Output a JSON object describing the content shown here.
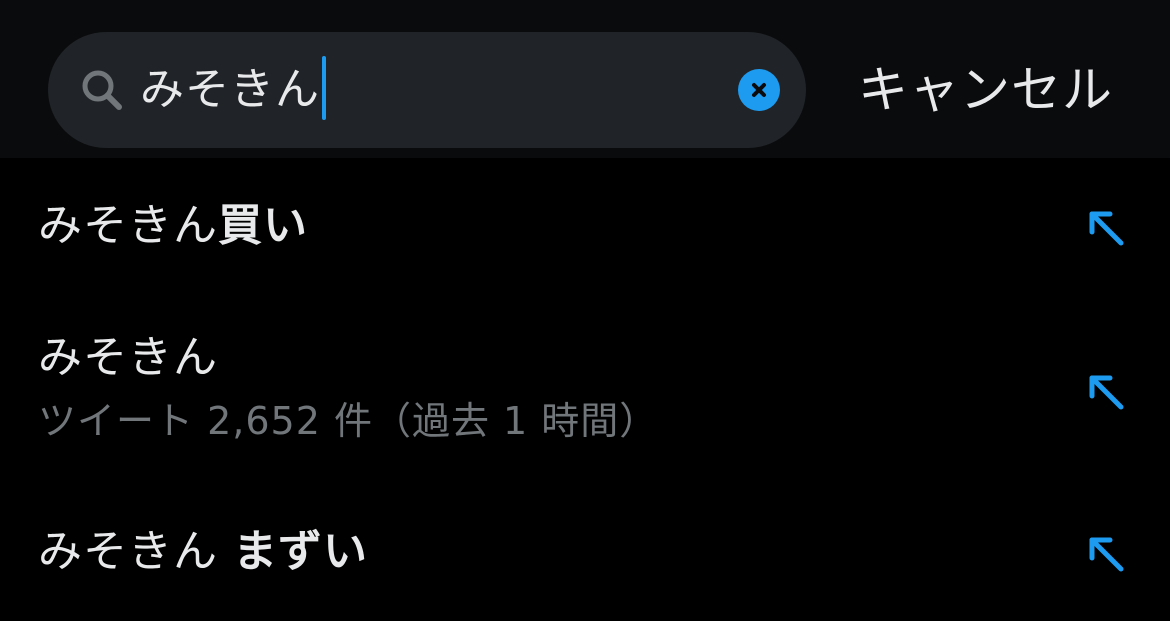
{
  "search": {
    "query": "みそきん",
    "cancel_label": "キャンセル"
  },
  "suggestions": [
    {
      "query_part": "みそきん",
      "completion_part": "買い",
      "icon": "arrow-up-left-icon"
    },
    {
      "query_part": "みそきん",
      "completion_part": "",
      "subtitle": "ツイート 2,652 件（過去 1 時間）",
      "icon": "arrow-up-left-icon"
    },
    {
      "query_part": "みそきん",
      "completion_part": "まずい",
      "icon": "arrow-up-left-icon"
    }
  ],
  "colors": {
    "accent": "#1d9bf0",
    "background": "#000000",
    "header_background": "#0a0b0d",
    "search_field": "#202327",
    "primary_text": "#e7e9ea",
    "secondary_text": "#71767b"
  }
}
